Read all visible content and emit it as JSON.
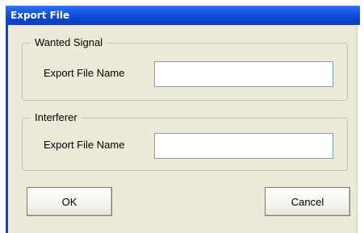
{
  "window": {
    "title": "Export File"
  },
  "wanted_signal": {
    "group_label": "Wanted Signal",
    "file_name_label": "Export File Name",
    "file_name_value": ""
  },
  "interferer": {
    "group_label": "Interferer",
    "file_name_label": "Export File Name",
    "file_name_value": ""
  },
  "buttons": {
    "ok_label": "OK",
    "cancel_label": "Cancel"
  },
  "colors": {
    "titlebar": "#0a43d4",
    "dialog_background": "#ece9d8",
    "input_border": "#7f9db9"
  }
}
